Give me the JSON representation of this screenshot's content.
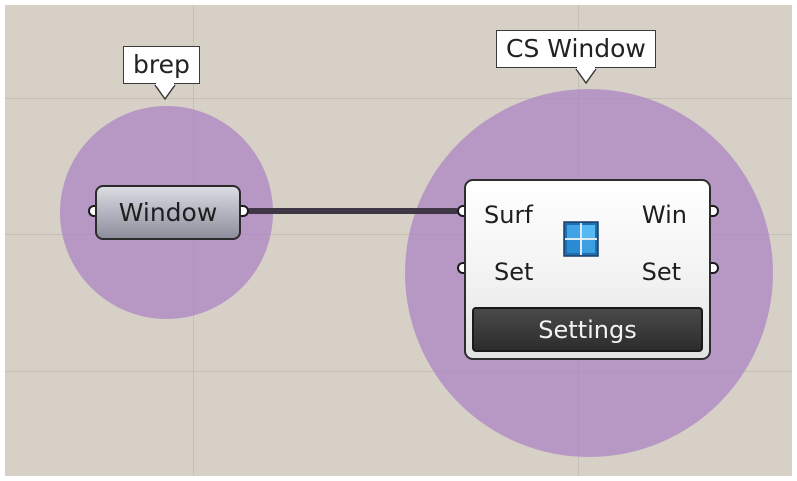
{
  "canvas": {
    "background_color": "#d6d0c7",
    "group_color": "#aa82c3"
  },
  "groups": [
    {
      "tag_label": "brep"
    },
    {
      "tag_label": "CS Window"
    }
  ],
  "param_node": {
    "label": "Window"
  },
  "component": {
    "inputs": [
      "Surf",
      "Set"
    ],
    "outputs": [
      "Win",
      "Set"
    ],
    "icon": "window-icon",
    "settings_label": "Settings"
  }
}
